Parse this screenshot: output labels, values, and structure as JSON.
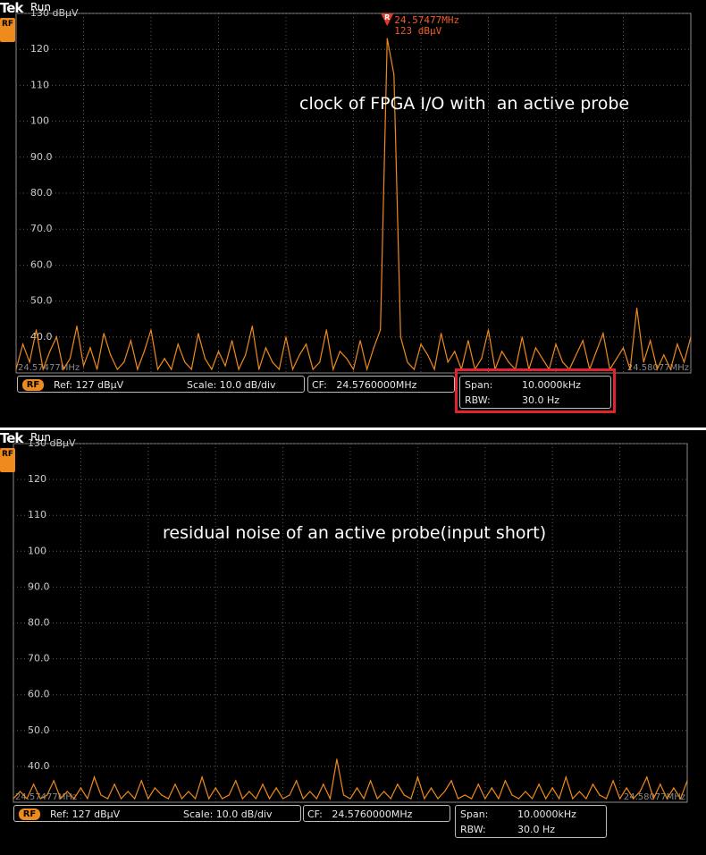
{
  "colors": {
    "trace": "#ef8a1c",
    "marker": "#e53a2b",
    "marker_text": "#ef5a2a",
    "grid": "#5a5a5a",
    "highlight_box": "#e0232e"
  },
  "panels": [
    {
      "brand": "Tek",
      "status": "Run",
      "rf_icon": "RF",
      "annotation": "clock of FPGA I/O with  an active probe",
      "marker": {
        "label": "R",
        "frequency": "24.57477MHz",
        "level": "123 dBµV"
      },
      "edge_labels": {
        "left": "24.57477MHz",
        "right": "24.58077MHz"
      },
      "status_bar": {
        "rf_badge": "RF",
        "ref": "Ref: 127 dBµV",
        "scale": "Scale: 10.0 dB/div",
        "cf": "CF:   24.5760000MHz",
        "span_label": "Span:",
        "span_value": "10.0000kHz",
        "rbw_label": "RBW:",
        "rbw_value": "30.0 Hz"
      },
      "highlighted": true
    },
    {
      "brand": "Tek",
      "status": "Run",
      "rf_icon": "RF",
      "annotation": "residual noise of an active probe(input short)",
      "edge_labels": {
        "left": "24.57477MHz",
        "right": "24.58077MHz"
      },
      "status_bar": {
        "rf_badge": "RF",
        "ref": "Ref: 127 dBµV",
        "scale": "Scale: 10.0 dB/div",
        "cf": "CF:   24.5760000MHz",
        "span_label": "Span:",
        "span_value": "10.0000kHz",
        "rbw_label": "RBW:",
        "rbw_value": "30.0 Hz"
      },
      "highlighted": false
    }
  ],
  "chart_data": [
    {
      "type": "line",
      "title": "",
      "xlabel": "",
      "ylabel": "",
      "ylim": [
        30,
        130
      ],
      "y_ticks": [
        "130 dBµV",
        "120",
        "110",
        "100",
        "90.0",
        "80.0",
        "70.0",
        "60.0",
        "50.0",
        "40.0"
      ],
      "y_tick_values": [
        130,
        120,
        110,
        100,
        90,
        80,
        70,
        60,
        50,
        40
      ],
      "grid": true,
      "series": [
        {
          "description_free": true,
          "x": [
            0,
            0.5,
            1,
            1.5,
            2,
            2.5,
            3,
            3.5,
            4,
            4.5,
            5,
            5.5,
            6,
            6.5,
            7,
            7.5,
            8,
            8.5,
            9,
            9.5,
            10,
            10.5,
            11,
            11.5,
            12,
            12.5,
            13,
            13.5,
            14,
            14.5,
            15,
            15.5,
            16,
            16.5,
            17,
            17.5,
            18,
            18.5,
            19,
            19.5,
            20,
            20.5,
            21,
            21.5,
            22,
            22.5,
            23,
            23.5,
            24,
            24.5,
            25,
            25.5,
            26,
            26.5,
            27,
            27.5,
            28,
            28.5,
            29,
            29.5,
            30,
            30.5,
            31,
            31.5,
            32,
            32.5,
            33,
            33.5,
            34,
            34.5,
            35,
            35.5,
            36,
            36.5,
            37,
            37.5,
            38,
            38.5,
            39,
            39.5,
            40,
            40.5,
            41,
            41.5,
            42,
            42.5,
            43,
            43.5,
            44,
            44.5,
            45,
            45.5,
            46,
            46.5,
            47,
            47.5,
            48,
            48.5,
            49,
            49.5,
            50
          ],
          "values": [
            31,
            38,
            33,
            42,
            31,
            36,
            40,
            31,
            34,
            43,
            32,
            37,
            31,
            41,
            35,
            31,
            33,
            39,
            31,
            36,
            42,
            31,
            34,
            31,
            38,
            33,
            31,
            41,
            34,
            31,
            36,
            32,
            39,
            31,
            35,
            43,
            31,
            37,
            33,
            31,
            40,
            31,
            35,
            38,
            31,
            33,
            42,
            31,
            36,
            34,
            31,
            39,
            31,
            37,
            42,
            123,
            113,
            40,
            33,
            31,
            38,
            35,
            31,
            41,
            33,
            36,
            31,
            39,
            31,
            34,
            42,
            31,
            36,
            33,
            31,
            40,
            31,
            37,
            34,
            31,
            38,
            33,
            31,
            35,
            39,
            31,
            36,
            41,
            31,
            34,
            37,
            31,
            48,
            33,
            39,
            31,
            35,
            31,
            38,
            33,
            40
          ]
        }
      ]
    },
    {
      "type": "line",
      "title": "",
      "xlabel": "",
      "ylabel": "",
      "ylim": [
        30,
        130
      ],
      "y_ticks": [
        "130 dBµV",
        "120",
        "110",
        "100",
        "90.0",
        "80.0",
        "70.0",
        "60.0",
        "50.0",
        "40.0"
      ],
      "y_tick_values": [
        130,
        120,
        110,
        100,
        90,
        80,
        70,
        60,
        50,
        40
      ],
      "grid": true,
      "series": [
        {
          "x": [
            0,
            0.5,
            1,
            1.5,
            2,
            2.5,
            3,
            3.5,
            4,
            4.5,
            5,
            5.5,
            6,
            6.5,
            7,
            7.5,
            8,
            8.5,
            9,
            9.5,
            10,
            10.5,
            11,
            11.5,
            12,
            12.5,
            13,
            13.5,
            14,
            14.5,
            15,
            15.5,
            16,
            16.5,
            17,
            17.5,
            18,
            18.5,
            19,
            19.5,
            20,
            20.5,
            21,
            21.5,
            22,
            22.5,
            23,
            23.5,
            24,
            24.5,
            25,
            25.5,
            26,
            26.5,
            27,
            27.5,
            28,
            28.5,
            29,
            29.5,
            30,
            30.5,
            31,
            31.5,
            32,
            32.5,
            33,
            33.5,
            34,
            34.5,
            35,
            35.5,
            36,
            36.5,
            37,
            37.5,
            38,
            38.5,
            39,
            39.5,
            40,
            40.5,
            41,
            41.5,
            42,
            42.5,
            43,
            43.5,
            44,
            44.5,
            45,
            45.5,
            46,
            46.5,
            47,
            47.5,
            48,
            48.5,
            49,
            49.5,
            50
          ],
          "values": [
            31,
            33,
            31,
            35,
            31,
            32,
            36,
            31,
            33,
            31,
            34,
            31,
            37,
            32,
            31,
            35,
            31,
            33,
            31,
            36,
            31,
            34,
            32,
            31,
            35,
            31,
            33,
            31,
            37,
            31,
            34,
            31,
            32,
            36,
            31,
            33,
            31,
            35,
            31,
            34,
            31,
            32,
            36,
            31,
            33,
            31,
            35,
            31,
            42,
            32,
            31,
            34,
            31,
            36,
            31,
            33,
            31,
            35,
            32,
            31,
            37,
            31,
            34,
            31,
            33,
            36,
            31,
            32,
            31,
            35,
            31,
            34,
            31,
            36,
            32,
            31,
            33,
            31,
            35,
            31,
            34,
            31,
            37,
            31,
            33,
            31,
            35,
            32,
            31,
            36,
            31,
            34,
            31,
            33,
            37,
            31,
            35,
            31,
            34,
            31,
            36
          ]
        }
      ]
    }
  ]
}
